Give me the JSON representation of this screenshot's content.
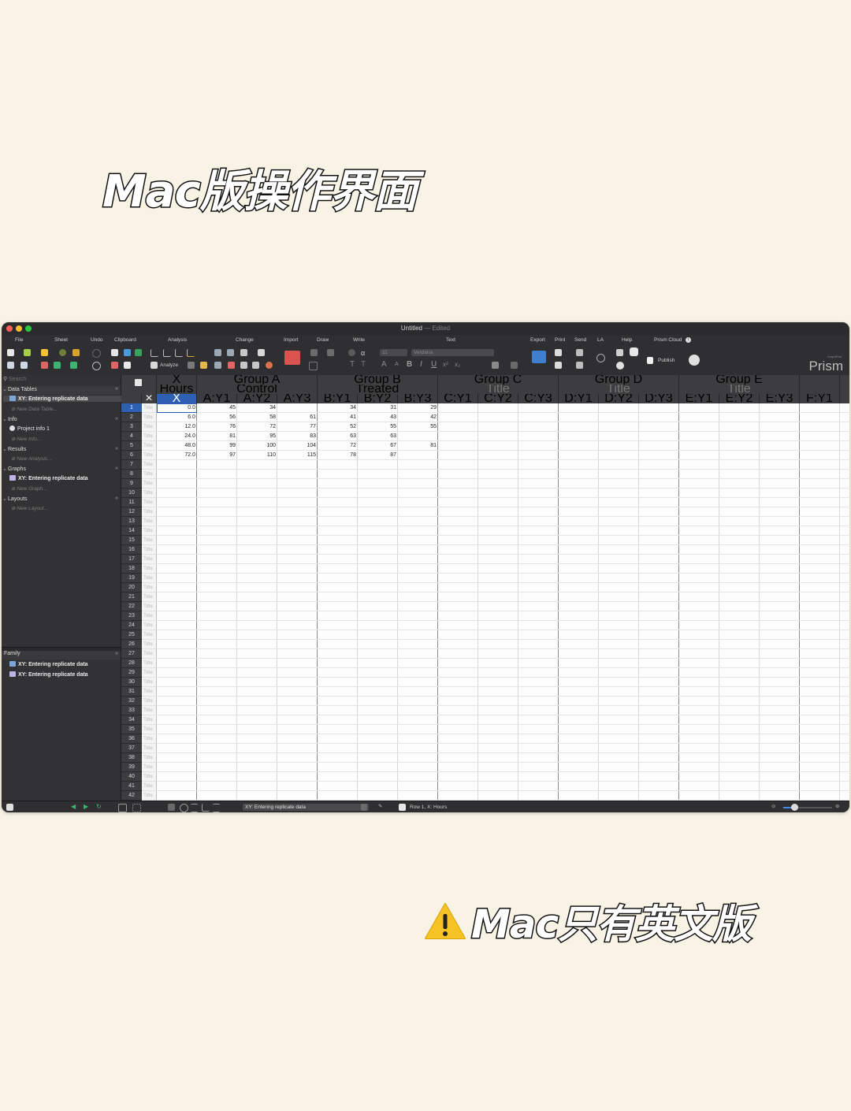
{
  "headline_top": "Mac版操作界面",
  "headline_bottom": "Mac只有英文版",
  "window": {
    "title": "Untitled",
    "title_sep": " — ",
    "title_state": "Edited",
    "brand": "Prism",
    "brand_small": "GraphPad"
  },
  "toolbar": {
    "groups": [
      "File",
      "Sheet",
      "Undo",
      "Clipboard",
      "Analysis",
      "Change",
      "Import",
      "Draw",
      "Write",
      "Text",
      "Export",
      "Print",
      "Send",
      "LA",
      "Help",
      "Prism Cloud"
    ],
    "analyze_label": "Analyze",
    "font_size": "11",
    "font_name": "Verdana",
    "publish_label": "Publish"
  },
  "sidebar": {
    "search_placeholder": "Search",
    "sections": {
      "data_tables": "Data Tables",
      "info": "Info",
      "results": "Results",
      "graphs": "Graphs",
      "layouts": "Layouts"
    },
    "items": {
      "data_table": "XY: Entering replicate data",
      "new_data_table": "New Data Table...",
      "project_info": "Project info 1",
      "new_info": "New Info...",
      "new_analysis": "New Analysis...",
      "graph": "XY: Entering replicate data",
      "new_graph": "New Graph...",
      "new_layout": "New Layout..."
    },
    "family_label": "Family",
    "family_items": [
      "XY: Entering replicate data",
      "XY: Entering replicate data"
    ]
  },
  "table": {
    "x_header": "X",
    "x_title": "Hours",
    "x_sub": "X",
    "groups": [
      {
        "name": "Group A",
        "title": "Control"
      },
      {
        "name": "Group B",
        "title": "Treated"
      },
      {
        "name": "Group C",
        "title": "Title"
      },
      {
        "name": "Group D",
        "title": "Title"
      },
      {
        "name": "Group E",
        "title": "Title"
      }
    ],
    "subcolumns": [
      "A:Y1",
      "A:Y2",
      "A:Y3",
      "B:Y1",
      "B:Y2",
      "B:Y3",
      "C:Y1",
      "C:Y2",
      "C:Y3",
      "D:Y1",
      "D:Y2",
      "D:Y3",
      "E:Y1",
      "E:Y2",
      "E:Y3",
      "F:Y1"
    ],
    "corner_mark": "×",
    "row_title": "Title",
    "row_count": 42,
    "rows": [
      {
        "x": "0.0",
        "y": [
          "45",
          "34",
          "",
          "34",
          "31",
          "29"
        ]
      },
      {
        "x": "6.0",
        "y": [
          "56",
          "58",
          "61",
          "41",
          "43",
          "42"
        ]
      },
      {
        "x": "12.0",
        "y": [
          "76",
          "72",
          "77",
          "52",
          "55",
          "55"
        ]
      },
      {
        "x": "24.0",
        "y": [
          "81",
          "95",
          "83",
          "63",
          "63",
          ""
        ]
      },
      {
        "x": "48.0",
        "y": [
          "99",
          "100",
          "104",
          "72",
          "67",
          "81"
        ]
      },
      {
        "x": "72.0",
        "y": [
          "97",
          "110",
          "115",
          "78",
          "87",
          ""
        ]
      }
    ]
  },
  "status": {
    "sheet_name": "XY: Entering replicate data",
    "position": "Row 1, X: Hours"
  },
  "colors": {
    "background": "#f8f3e4",
    "window": "#2b2b2d",
    "selection": "#2d5fb3",
    "close": "#ff5f57",
    "minimize": "#febc2e",
    "zoom": "#28c840"
  }
}
